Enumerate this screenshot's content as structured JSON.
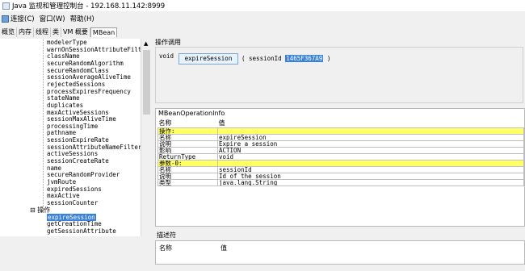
{
  "window": {
    "title": "Java 监视和管理控制台 - 192.168.11.142:8999"
  },
  "menu": {
    "connect": "连接(C)",
    "window": "窗口(W)",
    "help": "帮助(H)"
  },
  "tabs": [
    "概览",
    "内存",
    "线程",
    "类",
    "VM 概要",
    "MBean"
  ],
  "tree": {
    "attributes": [
      "modelerType",
      "warnOnSessionAttributeFilte",
      "className",
      "secureRandomAlgorithm",
      "secureRandomClass",
      "sessionAverageAliveTime",
      "rejectedSessions",
      "processExpiresFrequency",
      "stateName",
      "duplicates",
      "maxActiveSessions",
      "sessionMaxAliveTime",
      "processingTime",
      "pathname",
      "sessionExpireRate",
      "sessionAttributeNameFilter",
      "activeSessions",
      "sessionCreateRate",
      "name",
      "secureRandomProvider",
      "jvmRoute",
      "expiredSessions",
      "maxActive",
      "sessionCounter"
    ],
    "operations_folder": "操作",
    "operations": [
      "expireSession",
      "getCreationTime",
      "getSessionAttribute"
    ]
  },
  "operation_invocation": {
    "title": "操作调用",
    "return_type": "void",
    "button": "expireSession",
    "param_open": "( sessionId",
    "param_value": "1465F367A9",
    "param_close": ")"
  },
  "info": {
    "title": "MBeanOperationInfo",
    "header": [
      "名称",
      "值"
    ],
    "rows": [
      [
        "操作:",
        ""
      ],
      [
        "名称",
        "expireSession"
      ],
      [
        "说明",
        "Expire a session"
      ],
      [
        "影响",
        "ACTION"
      ],
      [
        "ReturnType",
        "void"
      ],
      [
        "参数-0:",
        ""
      ],
      [
        "名称",
        "sessionId"
      ],
      [
        "说明",
        "Id of the session"
      ],
      [
        "类型",
        "java.lang.String"
      ]
    ]
  },
  "descriptor": {
    "title": "描述符",
    "header": [
      "名称",
      "值"
    ]
  }
}
